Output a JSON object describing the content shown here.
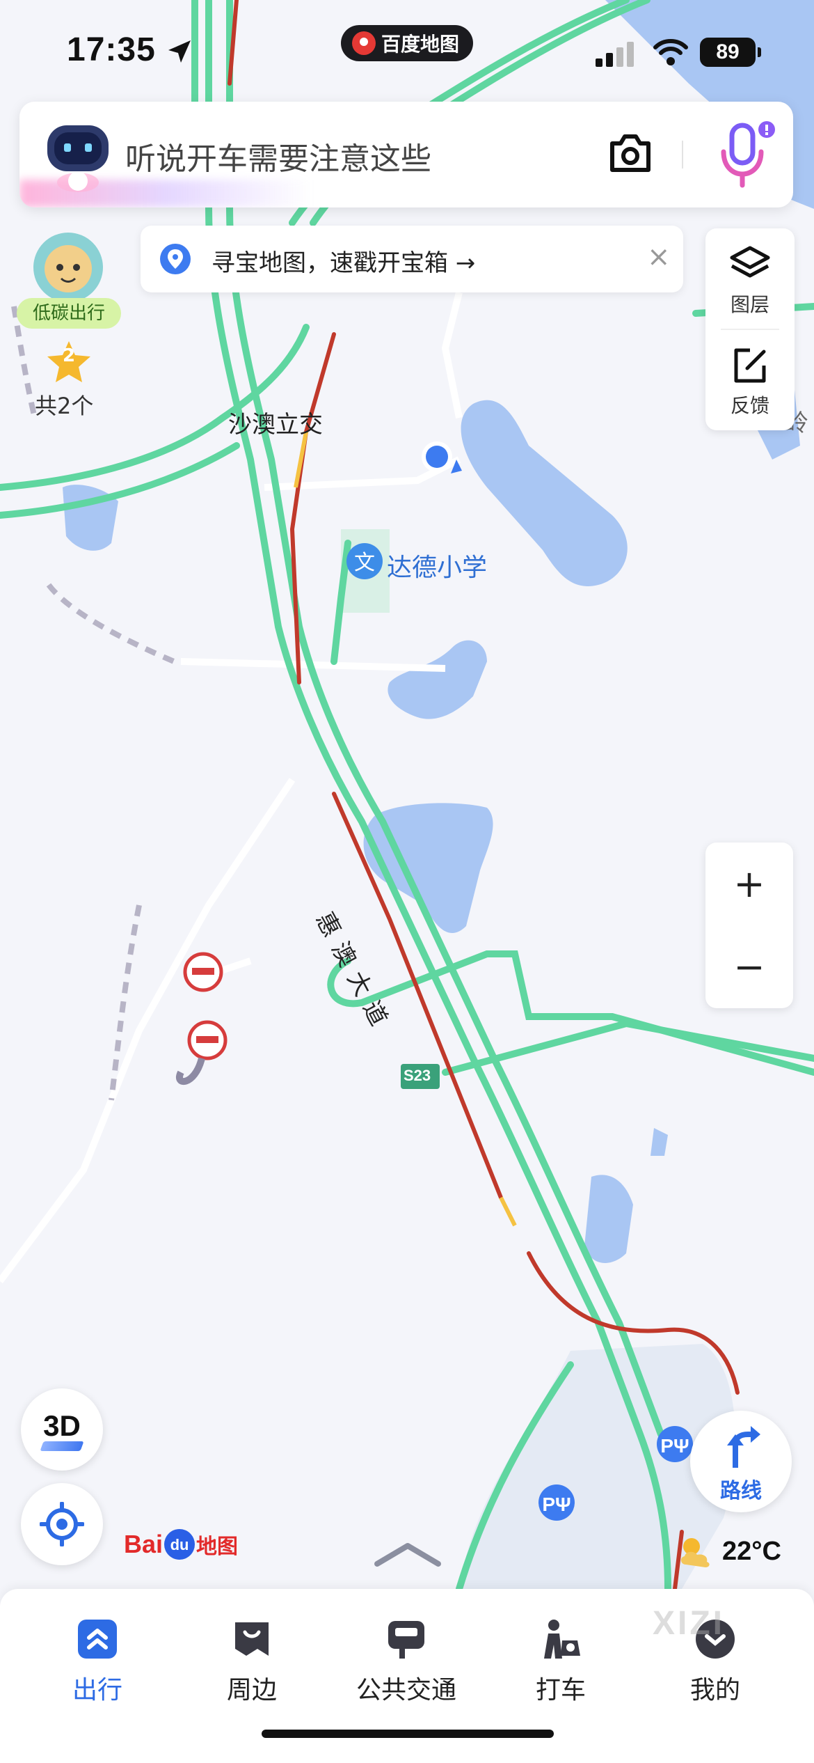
{
  "status_bar": {
    "time": "17:35",
    "app_badge": "百度地图",
    "battery": "89"
  },
  "search": {
    "placeholder": "听说开车需要注意这些"
  },
  "banner": {
    "text": "寻宝地图，速戳开宝箱 →",
    "close": "×"
  },
  "low_carbon": {
    "label": "低碳出行",
    "stars": "2",
    "count_label": "共2个"
  },
  "layers": {
    "layers_label": "图层",
    "feedback_label": "反馈"
  },
  "zoom": {
    "in": "+",
    "out": "−"
  },
  "map_labels": {
    "interchange": "沙澳立交",
    "school": "达德小学",
    "road": "惠澳大道",
    "highway_shield": "S23",
    "edge_fragment": "岭"
  },
  "controls": {
    "three_d": "3D",
    "route": "路线"
  },
  "logo": {
    "bai": "Bai",
    "du": "du",
    "cn": "地图"
  },
  "weather": {
    "temperature": "22°C"
  },
  "tabs": [
    {
      "label": "出行",
      "icon": "travel-icon",
      "active": true
    },
    {
      "label": "周边",
      "icon": "nearby-icon",
      "active": false
    },
    {
      "label": "公共交通",
      "icon": "transit-icon",
      "active": false
    },
    {
      "label": "打车",
      "icon": "taxi-icon",
      "active": false
    },
    {
      "label": "我的",
      "icon": "profile-icon",
      "active": false
    }
  ],
  "watermark": "XIZI",
  "colors": {
    "road_green": "#5fd6a0",
    "road_red": "#c0392b",
    "road_yellow": "#f5c242",
    "water": "#a9c6f3",
    "accent": "#2d6be4",
    "background": "#f4f5fa"
  }
}
